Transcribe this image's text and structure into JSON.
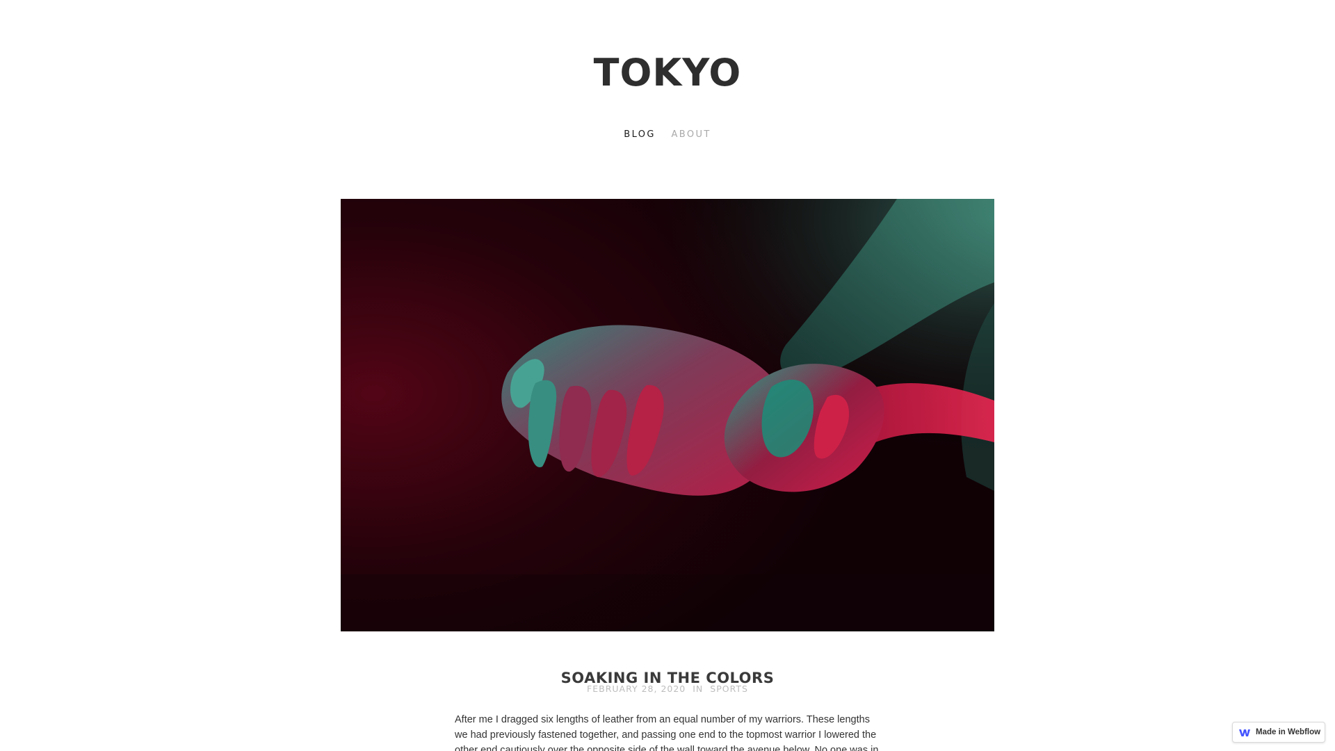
{
  "site": {
    "brand": "TOKYO"
  },
  "nav": {
    "items": [
      {
        "label": "BLOG",
        "state": "current"
      },
      {
        "label": "ABOUT",
        "state": "default"
      }
    ]
  },
  "post": {
    "title": "SOAKING IN THE COLORS",
    "date": "FEBRUARY 28, 2020",
    "category_prefix": "IN",
    "category": "SPORTS",
    "body": "After me I dragged six lengths of leather from an equal number of my warriors. These lengths we had previously fastened together, and passing one end to the topmost warrior I lowered the other end cautiously over the opposite side of the wall toward the avenue below. No one was in sight."
  },
  "badge": {
    "label": "Made in Webflow",
    "icon": "webflow-logo-icon"
  },
  "colors": {
    "text": "#333333",
    "nav_muted": "#a9a9a9",
    "meta": "#bdbdbd",
    "webflow_blue": "#4353ff"
  }
}
